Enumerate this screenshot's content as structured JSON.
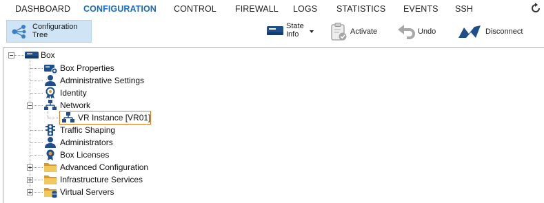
{
  "nav": {
    "tabs": [
      {
        "label": "DASHBOARD"
      },
      {
        "label": "CONFIGURATION"
      },
      {
        "label": "CONTROL"
      },
      {
        "label": "FIREWALL"
      },
      {
        "label": "LOGS"
      },
      {
        "label": "STATISTICS"
      },
      {
        "label": "EVENTS"
      },
      {
        "label": "SSH"
      }
    ],
    "active_tab": "CONFIGURATION",
    "refresh_icon": "refresh-icon",
    "active_color": "#1a6bbd"
  },
  "toolbar": {
    "config_tree_line1": "Configuration",
    "config_tree_line2": "Tree",
    "state_info_line1": "State",
    "state_info_line2": "Info",
    "activate": "Activate",
    "undo": "Undo",
    "disconnect": "Disconnect"
  },
  "tree": {
    "root": {
      "label": "Box",
      "icon": "server-icon"
    },
    "items": [
      {
        "label": "Box Properties",
        "icon": "box-properties-icon"
      },
      {
        "label": "Administrative Settings",
        "icon": "admin-user-icon"
      },
      {
        "label": "Identity",
        "icon": "identity-badge-icon"
      },
      {
        "label": "Network",
        "icon": "network-icon"
      },
      {
        "label": "VR Instance [VR01]",
        "icon": "network-icon"
      },
      {
        "label": "Traffic Shaping",
        "icon": "traffic-light-icon"
      },
      {
        "label": "Administrators",
        "icon": "admin-user-icon"
      },
      {
        "label": "Box Licenses",
        "icon": "license-icon"
      },
      {
        "label": "Advanced Configuration",
        "icon": "folder-icon"
      },
      {
        "label": "Infrastructure Services",
        "icon": "folder-icon"
      },
      {
        "label": "Virtual Servers",
        "icon": "folder-database-icon"
      }
    ],
    "selected_item": "VR Instance [VR01]",
    "selection_color": "#e07b1a"
  }
}
